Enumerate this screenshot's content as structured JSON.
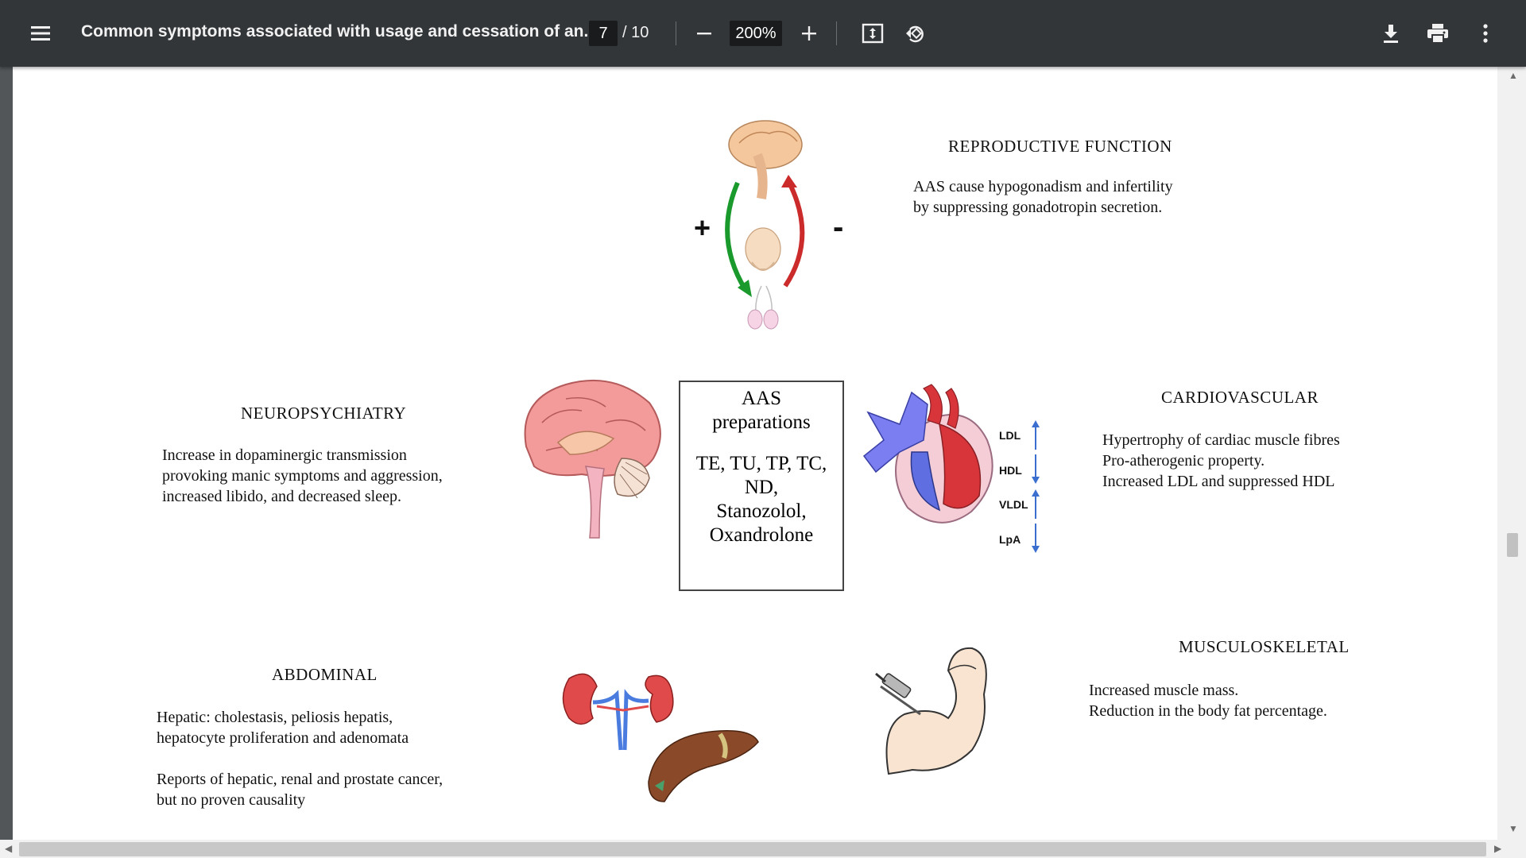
{
  "toolbar": {
    "title": "Common symptoms associated with usage and cessation of an...",
    "current_page": "7",
    "total_pages": "/ 10",
    "zoom": "200%",
    "icons": [
      "menu-icon",
      "zoom-out-icon",
      "zoom-in-icon",
      "fit-page-icon",
      "rotate-icon",
      "download-icon",
      "print-icon",
      "more-icon"
    ]
  },
  "document": {
    "reproductive": {
      "heading": "REPRODUCTIVE FUNCTION",
      "lines": [
        "AAS cause hypogonadism and infertility",
        "by suppressing gonadotropin secretion."
      ],
      "plus": "+",
      "minus": "-"
    },
    "center": {
      "title_lines": [
        "AAS",
        "preparations"
      ],
      "list_lines": [
        "TE, TU, TP, TC,",
        "ND,",
        "Stanozolol,",
        "Oxandrolone"
      ]
    },
    "neuro": {
      "heading": "NEUROPSYCHIATRY",
      "lines": [
        "Increase in dopaminergic transmission",
        "provoking manic symptoms and aggression,",
        "increased libido, and decreased sleep."
      ]
    },
    "cardio": {
      "heading": "CARDIOVASCULAR",
      "lines": [
        "Hypertrophy of cardiac muscle fibres",
        "Pro-atherogenic property.",
        "Increased LDL and suppressed HDL"
      ],
      "lipids": [
        {
          "label": "LDL",
          "direction": "up"
        },
        {
          "label": "HDL",
          "direction": "down"
        },
        {
          "label": "VLDL",
          "direction": "up"
        },
        {
          "label": "LpA",
          "direction": "down"
        }
      ]
    },
    "muscle": {
      "heading": "MUSCULOSKELETAL",
      "lines": [
        "Increased muscle mass.",
        "Reduction in the body fat percentage."
      ]
    },
    "abdominal": {
      "heading": "ABDOMINAL",
      "lines": [
        "Hepatic: cholestasis, peliosis hepatis,",
        "hepatocyte proliferation and  adenomata"
      ],
      "lines2": [
        "Reports of hepatic, renal and prostate cancer,",
        "but no proven causality"
      ]
    }
  },
  "colors": {
    "toolbar_bg": "#323639",
    "viewer_bg": "#525659",
    "green_arrow": "#1a9a2c",
    "red_arrow": "#cc2b2b",
    "lipid_arrow": "#3a6fd0"
  }
}
